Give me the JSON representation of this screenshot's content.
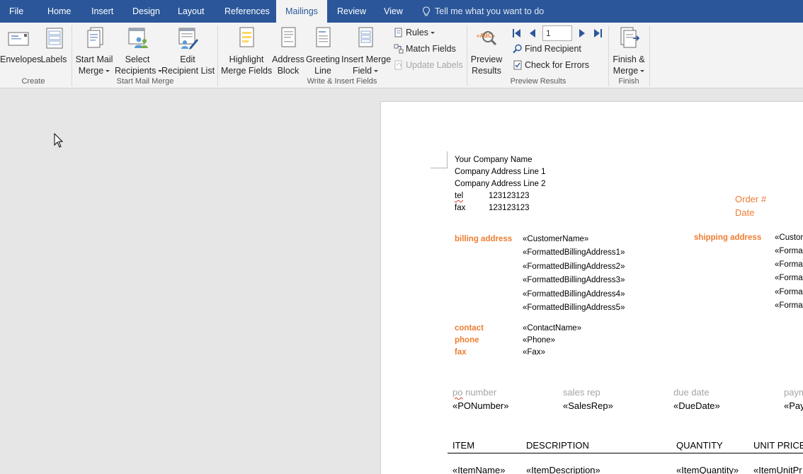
{
  "tabs": {
    "file": "File",
    "home": "Home",
    "insert": "Insert",
    "design": "Design",
    "layout": "Layout",
    "references": "References",
    "mailings": "Mailings",
    "review": "Review",
    "view": "View",
    "tell_me": "Tell me what you want to do"
  },
  "ribbon": {
    "create": {
      "label": "Create",
      "envelopes": "Envelopes",
      "labels": "Labels"
    },
    "start_mail_merge": {
      "label": "Start Mail Merge",
      "start_line1": "Start Mail",
      "start_line2": "Merge",
      "select_line1": "Select",
      "select_line2": "Recipients",
      "edit_line1": "Edit",
      "edit_line2": "Recipient List"
    },
    "write_insert": {
      "label": "Write & Insert Fields",
      "highlight_line1": "Highlight",
      "highlight_line2": "Merge Fields",
      "address_line1": "Address",
      "address_line2": "Block",
      "greeting_line1": "Greeting",
      "greeting_line2": "Line",
      "insert_line1": "Insert Merge",
      "insert_line2": "Field",
      "rules": "Rules",
      "match_fields": "Match Fields",
      "update_labels": "Update Labels"
    },
    "preview": {
      "label": "Preview Results",
      "preview_line1": "Preview",
      "preview_line2": "Results",
      "record_number": "1",
      "find_recipient": "Find Recipient",
      "check_errors": "Check for Errors"
    },
    "finish": {
      "label": "Finish",
      "finish_line1": "Finish &",
      "finish_line2": "Merge"
    }
  },
  "document": {
    "company_name": "Your Company Name",
    "address_line1": "Company Address Line 1",
    "address_line2": "Company Address Line 2",
    "tel_label": "tel",
    "tel_value": "123123123",
    "fax_label": "fax",
    "fax_value": "123123123",
    "order_label": "Order #",
    "date_label": "Date",
    "billing_label": "billing address",
    "billing_fields": [
      "«CustomerName»",
      "«FormattedBillingAddress1»",
      "«FormattedBillingAddress2»",
      "«FormattedBillingAddress3»",
      "«FormattedBillingAddress4»",
      "«FormattedBillingAddress5»"
    ],
    "shipping_label": "shipping address",
    "shipping_fields": [
      "«Custon",
      "«Forma",
      "«Forma",
      "«Forma",
      "«Forma",
      "«Forma"
    ],
    "contact_label": "contact",
    "phone_label": "phone",
    "fax2_label": "fax",
    "contact_value": "«ContactName»",
    "phone_value": "«Phone»",
    "fax2_value": "«Fax»",
    "po_label": "po number",
    "salesrep_label": "sales rep",
    "duedate_label": "due date",
    "payment_label": "paym",
    "po_value": "«PONumber»",
    "salesrep_value": "«SalesRep»",
    "duedate_value": "«DueDate»",
    "payment_value": "«Pay",
    "col_item": "ITEM",
    "col_description": "DESCRIPTION",
    "col_quantity": "QUANTITY",
    "col_unit_price": "UNIT PRICE",
    "row_item": "«ItemName»",
    "row_description": "«ItemDescription»",
    "row_quantity": "«ItemQuantity»",
    "row_unit_price": "«ItemUnitPr"
  }
}
